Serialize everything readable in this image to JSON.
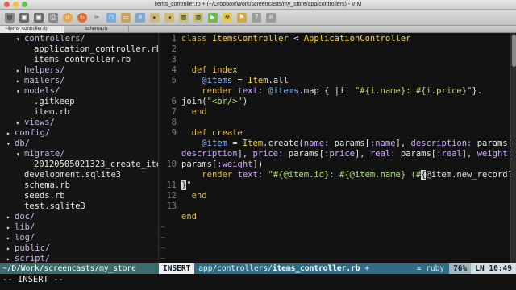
{
  "window": {
    "title": "items_controller.rb + (~/Dropbox/Work/screencasts/my_store/app/controllers) - VIM"
  },
  "toolbar": {
    "buttons": [
      "open-icon",
      "save-icon",
      "save-all-icon",
      "print-icon",
      "undo-icon",
      "redo-icon",
      "cut-icon",
      "copy-icon",
      "paste-icon",
      "find-icon",
      "find-next-icon",
      "find-prev-icon",
      "load-session-icon",
      "save-session-icon",
      "run-script-icon",
      "make-icon",
      "tags-icon",
      "help-icon",
      "find-help-icon"
    ]
  },
  "tabs": [
    {
      "label": "~items_controller.rb",
      "active": true
    },
    {
      "label": "schema.rb",
      "active": false
    }
  ],
  "tree": {
    "rows": [
      {
        "arrow": "▾",
        "text": "controllers/",
        "type": "dir",
        "indent": 1
      },
      {
        "arrow": "",
        "text": "application_controller.rb",
        "type": "file",
        "indent": 2
      },
      {
        "arrow": "",
        "text": "items_controller.rb",
        "type": "file",
        "indent": 2
      },
      {
        "arrow": "▸",
        "text": "helpers/",
        "type": "dir",
        "indent": 1
      },
      {
        "arrow": "▸",
        "text": "mailers/",
        "type": "dir",
        "indent": 1
      },
      {
        "arrow": "▾",
        "text": "models/",
        "type": "dir",
        "indent": 1
      },
      {
        "arrow": "",
        "text": ".gitkeep",
        "type": "file",
        "indent": 2
      },
      {
        "arrow": "",
        "text": "item.rb",
        "type": "file",
        "indent": 2
      },
      {
        "arrow": "▸",
        "text": "views/",
        "type": "dir",
        "indent": 1
      },
      {
        "arrow": "▸",
        "text": "config/",
        "type": "dir",
        "indent": 0
      },
      {
        "arrow": "▾",
        "text": "db/",
        "type": "dir",
        "indent": 0
      },
      {
        "arrow": "▾",
        "text": "migrate/",
        "type": "dir",
        "indent": 1
      },
      {
        "arrow": "",
        "text": "20120505021323_create_ite",
        "type": "file",
        "indent": 2
      },
      {
        "arrow": "",
        "text": "development.sqlite3",
        "type": "file",
        "indent": 1
      },
      {
        "arrow": "",
        "text": "schema.rb",
        "type": "file",
        "indent": 1
      },
      {
        "arrow": "",
        "text": "seeds.rb",
        "type": "file",
        "indent": 1
      },
      {
        "arrow": "",
        "text": "test.sqlite3",
        "type": "file",
        "indent": 1
      },
      {
        "arrow": "▸",
        "text": "doc/",
        "type": "dir",
        "indent": 0
      },
      {
        "arrow": "▸",
        "text": "lib/",
        "type": "dir",
        "indent": 0
      },
      {
        "arrow": "▸",
        "text": "log/",
        "type": "dir",
        "indent": 0
      },
      {
        "arrow": "▸",
        "text": "public/",
        "type": "dir",
        "indent": 0
      },
      {
        "arrow": "▸",
        "text": "script/",
        "type": "dir",
        "indent": 0
      }
    ]
  },
  "editor": {
    "line_numbers": [
      "1",
      "2",
      "3",
      "4",
      "5",
      "6",
      "7",
      "8",
      "9",
      "10",
      "11",
      "12",
      "13"
    ],
    "tilde": "~",
    "code": {
      "l1_kw": "class ",
      "l1_cls": "ItemsController",
      "l1_op": " < ",
      "l1_parent": "ApplicationController",
      "l3_kw": "def ",
      "l3_fn": "index",
      "l4_ivar": "@items",
      "l4_op": " = ",
      "l4_cls": "Item",
      "l4_rest": ".all",
      "l5_render": "render ",
      "l5_sym": "text:",
      "l5_ivar": " @items",
      "l5_rest": ".map { |i| ",
      "l5_str": "\"#{i.name}: #{i.price}\"",
      "l5_end": "}.",
      "l5b_join": "join(",
      "l5b_str": "\"<br/>\"",
      "l5b_close": ")",
      "l6_end": "end",
      "l8_kw": "def ",
      "l8_fn": "create",
      "l9_ivar": "@item",
      "l9_op": " = ",
      "l9_cls": "Item",
      "l9_a": ".create(",
      "l9_s1": "name:",
      "l9_b": " params[",
      "l9_s2": ":name",
      "l9_c": "], ",
      "l9_s3": "description:",
      "l9_d": " params[",
      "l9_s4": ":",
      "l9b_s1": "description",
      "l9b_a": "], ",
      "l9b_s2": "price:",
      "l9b_b": " params[",
      "l9b_s3": ":price",
      "l9b_c": "], ",
      "l9b_s4": "real:",
      "l9b_d": " params[",
      "l9b_s5": ":real",
      "l9b_e": "], ",
      "l9b_s6": "weight:",
      "l9c_s1": "params[",
      "l9c_s2": ":weight",
      "l9c_a": "])",
      "l10_render": "render ",
      "l10_sym": "text:",
      "l10_str1": " \"#{@item.id}: #{@item.name} (#",
      "l10_cur1": "{",
      "l10_str2": "@item.new_record?",
      "l10b_cur": "}",
      "l10b_str": "\"",
      "l11_end": "end",
      "l13_end": "end"
    }
  },
  "statusline": {
    "left": "~/D/Work/screencasts/my_store",
    "mode": "INSERT",
    "path_prefix": "app/controllers/",
    "filename": "items_controller.rb",
    "modified": " +",
    "filetype": "≡ ruby",
    "percent": "76%",
    "position": "LN  10:49"
  },
  "cmdline": "-- INSERT --",
  "colors": {
    "directory": "#c9b4e6",
    "keyword": "#d9b84f",
    "string": "#b5e07a",
    "symbol": "#d0a8ff",
    "ivar": "#8fbcff",
    "status": "#2d6d86"
  }
}
